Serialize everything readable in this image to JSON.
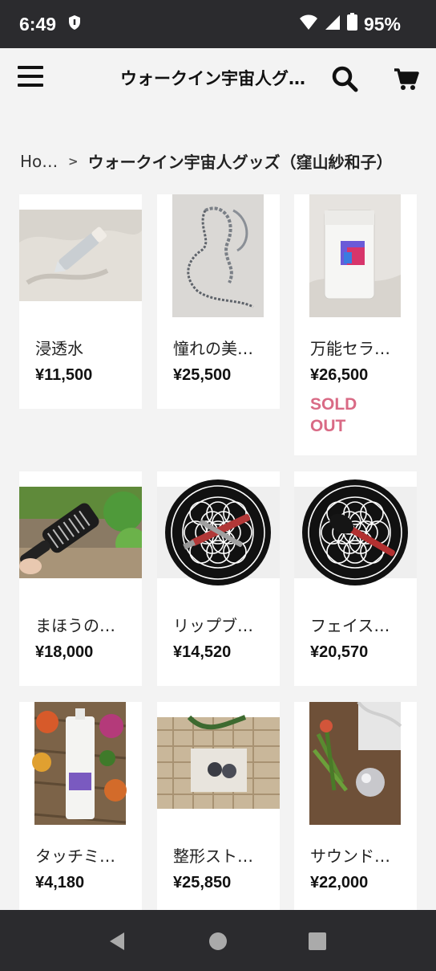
{
  "status_bar": {
    "time": "6:49",
    "battery": "95%",
    "icons": [
      "shield-icon",
      "wifi-icon",
      "signal-icon",
      "battery-icon"
    ]
  },
  "header": {
    "title": "ウォークイン宇宙人グッズ（窪山紗和子）",
    "icons": [
      "menu-icon",
      "search-icon",
      "cart-icon"
    ]
  },
  "breadcrumb": {
    "home": "Home",
    "separator": ">",
    "current": "ウォークイン宇宙人グッズ（窪山紗和子）"
  },
  "products": [
    {
      "name": "浸透水",
      "price": "¥11,500",
      "sold_out": ""
    },
    {
      "name": "憧れの美…",
      "price": "¥25,500",
      "sold_out": ""
    },
    {
      "name": "万能セラ…",
      "price": "¥26,500",
      "sold_out": "SOLD OUT"
    },
    {
      "name": "まほうの…",
      "price": "¥18,000",
      "sold_out": ""
    },
    {
      "name": "リップブ…",
      "price": "¥14,520",
      "sold_out": ""
    },
    {
      "name": "フェイス…",
      "price": "¥20,570",
      "sold_out": ""
    },
    {
      "name": "タッチミ…",
      "price": "¥4,180",
      "sold_out": ""
    },
    {
      "name": "整形スト…",
      "price": "¥25,850",
      "sold_out": ""
    },
    {
      "name": "サウンド…",
      "price": "¥22,000",
      "sold_out": ""
    }
  ],
  "colors": {
    "status_bar_bg": "#2b2b2e",
    "page_bg": "#f3f3f3",
    "sold_out": "#d96a85"
  },
  "nav_bar": {
    "icons": [
      "back-icon",
      "home-icon",
      "recents-icon"
    ]
  }
}
